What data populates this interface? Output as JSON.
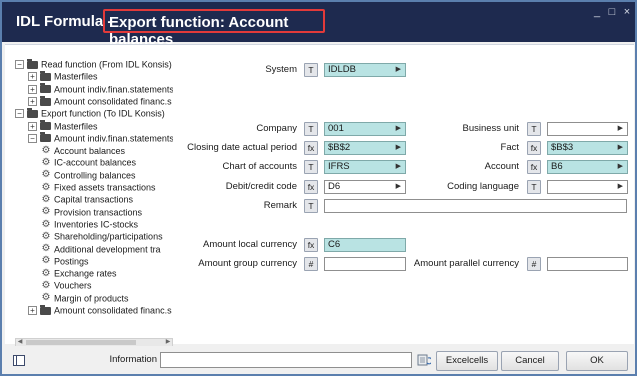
{
  "window": {
    "app_title": "IDL Formula -",
    "function_title": "Export function: Account balances",
    "controls": [
      "_",
      "□",
      "×"
    ]
  },
  "tree": {
    "items": [
      {
        "label": "Read function (From IDL Konsis)",
        "level": 0,
        "type": "folder",
        "toggle": "−"
      },
      {
        "label": "Masterfiles",
        "level": 1,
        "type": "folder",
        "toggle": "+"
      },
      {
        "label": "Amount indiv.finan.statements",
        "level": 1,
        "type": "folder",
        "toggle": "+"
      },
      {
        "label": "Amount consolidated financ.s",
        "level": 1,
        "type": "folder",
        "toggle": "+"
      },
      {
        "label": "Export function (To IDL Konsis)",
        "level": 0,
        "type": "folder",
        "toggle": "−"
      },
      {
        "label": "Masterfiles",
        "level": 1,
        "type": "folder",
        "toggle": "+"
      },
      {
        "label": "Amount indiv.finan.statements",
        "level": 1,
        "type": "folder",
        "toggle": "−"
      },
      {
        "label": "Account balances",
        "level": 2,
        "type": "function",
        "selected": true
      },
      {
        "label": "IC-account balances",
        "level": 2,
        "type": "function"
      },
      {
        "label": "Controlling balances",
        "level": 2,
        "type": "function"
      },
      {
        "label": "Fixed assets transactions",
        "level": 2,
        "type": "function"
      },
      {
        "label": "Capital transactions",
        "level": 2,
        "type": "function"
      },
      {
        "label": "Provision transactions",
        "level": 2,
        "type": "function"
      },
      {
        "label": "Inventories IC-stocks",
        "level": 2,
        "type": "function"
      },
      {
        "label": "Shareholding/participations",
        "level": 2,
        "type": "function"
      },
      {
        "label": "Additional development tra",
        "level": 2,
        "type": "function"
      },
      {
        "label": "Postings",
        "level": 2,
        "type": "function"
      },
      {
        "label": "Exchange rates",
        "level": 2,
        "type": "function"
      },
      {
        "label": "Vouchers",
        "level": 2,
        "type": "function"
      },
      {
        "label": "Margin of products",
        "level": 2,
        "type": "function"
      },
      {
        "label": "Amount consolidated financ.s",
        "level": 1,
        "type": "folder",
        "toggle": "+"
      }
    ]
  },
  "form": {
    "system": {
      "label": "System",
      "btn": "T",
      "value": "IDLDB"
    },
    "company": {
      "label": "Company",
      "btn": "T",
      "value": "001"
    },
    "closing_date": {
      "label": "Closing date actual period",
      "btn": "fx",
      "value": "$B$2"
    },
    "chart_of_accounts": {
      "label": "Chart of accounts",
      "btn": "T",
      "value": "IFRS"
    },
    "debit_credit_code": {
      "label": "Debit/credit code",
      "btn": "fx",
      "value": "D6"
    },
    "remark": {
      "label": "Remark",
      "btn": "T",
      "value": ""
    },
    "business_unit": {
      "label": "Business unit",
      "btn": "T",
      "value": ""
    },
    "fact": {
      "label": "Fact",
      "btn": "fx",
      "value": "$B$3"
    },
    "account": {
      "label": "Account",
      "btn": "fx",
      "value": "B6"
    },
    "coding_language": {
      "label": "Coding language",
      "btn": "T",
      "value": ""
    },
    "amount_local_currency": {
      "label": "Amount local currency",
      "btn": "fx",
      "value": "C6"
    },
    "amount_group_currency": {
      "label": "Amount group currency",
      "btn": "#",
      "value": ""
    },
    "amount_parallel_currency": {
      "label": "Amount parallel currency",
      "btn": "#",
      "value": ""
    }
  },
  "bottom": {
    "information_label": "Information",
    "information_value": "",
    "excelcells_label": "Excelcells",
    "cancel_label": "Cancel",
    "ok_label": "OK"
  },
  "colors": {
    "titlebar": "#1e2a4f",
    "highlight_box": "#e23a3a",
    "teal_field": "#b9e3e3"
  }
}
